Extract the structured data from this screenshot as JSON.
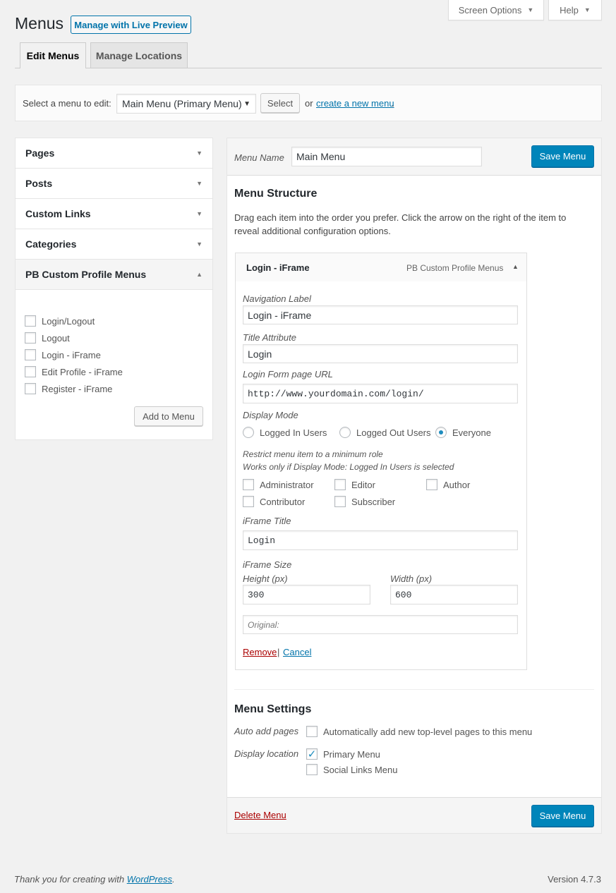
{
  "screen_options": {
    "label": "Screen Options"
  },
  "help": {
    "label": "Help"
  },
  "page": {
    "title": "Menus",
    "live_preview": "Manage with Live Preview"
  },
  "tabs": [
    {
      "label": "Edit Menus"
    },
    {
      "label": "Manage Locations"
    }
  ],
  "select_bar": {
    "prompt": "Select a menu to edit:",
    "selected": "Main Menu (Primary Menu)",
    "select_button": "Select",
    "or_text": "or",
    "create_link": "create a new menu",
    "period": "."
  },
  "accordion": {
    "sections": [
      {
        "label": "Pages"
      },
      {
        "label": "Posts"
      },
      {
        "label": "Custom Links"
      },
      {
        "label": "Categories"
      },
      {
        "label": "PB Custom Profile Menus"
      }
    ],
    "items": [
      {
        "label": "Login/Logout"
      },
      {
        "label": "Logout"
      },
      {
        "label": "Login - iFrame"
      },
      {
        "label": "Edit Profile - iFrame"
      },
      {
        "label": "Register - iFrame"
      }
    ],
    "add_button": "Add to Menu"
  },
  "editor": {
    "menu_name_label": "Menu Name",
    "menu_name_value": "Main Menu",
    "save_button": "Save Menu",
    "structure_title": "Menu Structure",
    "structure_desc_1": "Drag each item into the order you prefer. Click the arrow on the right of the item to",
    "structure_desc_2": "reveal additional configuration options.",
    "item": {
      "title": "Login - iFrame",
      "type": "PB Custom Profile Menus",
      "nav_label_label": "Navigation Label",
      "nav_label_value": "Login - iFrame",
      "title_attr_label": "Title Attribute",
      "title_attr_value": "Login",
      "form_url_label": "Login Form page URL",
      "form_url_value": "http://www.yourdomain.com/login/",
      "display_mode_label": "Display Mode",
      "display_modes": [
        {
          "label": "Logged In Users"
        },
        {
          "label": "Logged Out Users"
        },
        {
          "label": "Everyone"
        }
      ],
      "selected_mode": "Everyone",
      "restrict_line_1": "Restrict menu item to a minimum role",
      "restrict_line_2": "Works only if Display Mode: Logged In Users is selected",
      "roles": [
        {
          "label": "Administrator"
        },
        {
          "label": "Editor"
        },
        {
          "label": "Author"
        },
        {
          "label": "Contributor"
        },
        {
          "label": "Subscriber"
        }
      ],
      "iframe_title_label": "iFrame Title",
      "iframe_title_value": "Login",
      "iframe_size_label": "iFrame Size",
      "height_label": "Height (px)",
      "height_value": "300",
      "width_label": "Width (px)",
      "width_value": "600",
      "original_placeholder": "Original:",
      "remove": "Remove",
      "separator": "|",
      "cancel": "Cancel"
    },
    "settings_title": "Menu Settings",
    "auto_add_label": "Auto add pages",
    "auto_add_text": "Automatically add new top-level pages to this menu",
    "display_location_label": "Display location",
    "locations": [
      {
        "label": "Primary Menu",
        "checked": true
      },
      {
        "label": "Social Links Menu",
        "checked": false
      }
    ],
    "delete_link": "Delete Menu"
  },
  "footer": {
    "thanks_prefix": "Thank you for creating with",
    "wordpress_link": "WordPress",
    "thanks_suffix": ".",
    "version": "Version 4.7.3"
  },
  "colors": {
    "primary": "#0085ba",
    "link": "#0073aa",
    "delete": "#a00",
    "background": "#f1f1f1"
  }
}
